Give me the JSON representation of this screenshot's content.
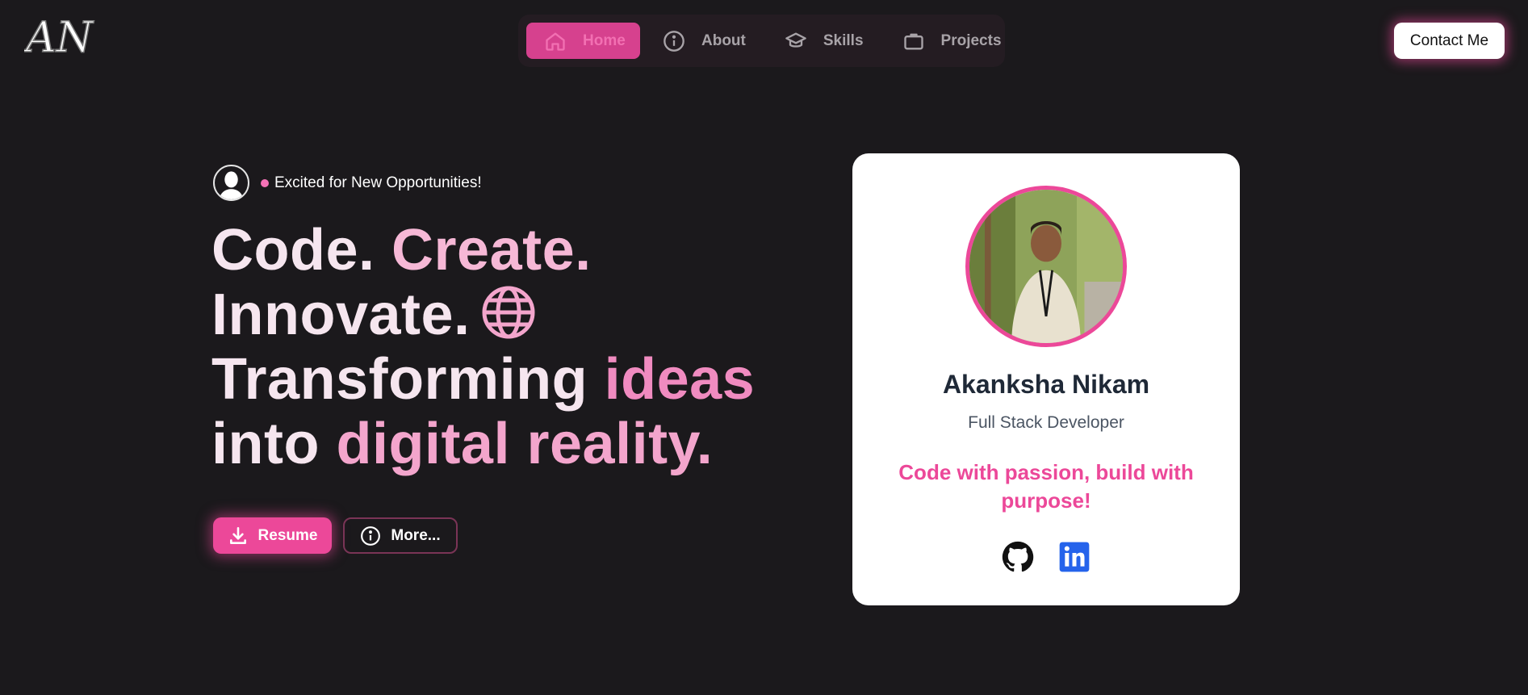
{
  "logo": {
    "text": "AN"
  },
  "nav": {
    "items": [
      {
        "label": "Home",
        "icon": "home-icon",
        "active": true
      },
      {
        "label": "About",
        "icon": "info-icon"
      },
      {
        "label": "Skills",
        "icon": "graduation-cap-icon"
      },
      {
        "label": "Projects",
        "icon": "briefcase-icon"
      }
    ]
  },
  "header": {
    "contact_label": "Contact Me"
  },
  "hero": {
    "status": "Excited for New Opportunities!",
    "headline": {
      "code": "Code.",
      "create": "Create.",
      "innovate": "Innovate.",
      "transforming": "Transforming",
      "ideas": "ideas",
      "into": "into",
      "digital_reality": "digital reality."
    },
    "resume_label": "Resume",
    "more_label": "More..."
  },
  "card": {
    "name": "Akanksha Nikam",
    "role": "Full Stack Developer",
    "quote": "Code with passion, build with purpose!",
    "socials": [
      "github-icon",
      "linkedin-icon"
    ]
  },
  "colors": {
    "background": "#1b191c",
    "accent": "#ec4899",
    "nav_active": "#d6418e",
    "card_bg": "#ffffff"
  }
}
